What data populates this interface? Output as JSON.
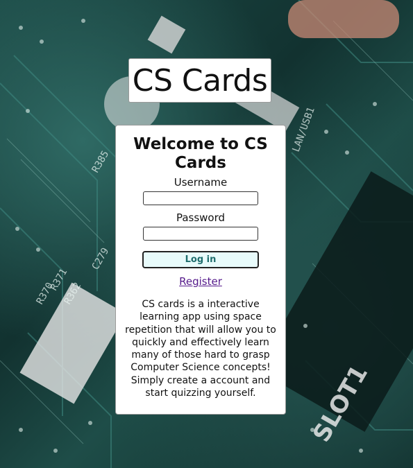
{
  "app": {
    "title": "CS Cards"
  },
  "login": {
    "heading": "Welcome to CS Cards",
    "username_label": "Username",
    "username_value": "",
    "password_label": "Password",
    "password_value": "",
    "login_button": "Log in",
    "register_link": "Register"
  },
  "description": "CS cards is a interactive learning app using space repetition that will allow you to quickly and effectively learn many of those hard to grasp Computer Science concepts! Simply create a account and start quizzing yourself.",
  "background": {
    "imprints": [
      "R385",
      "R371",
      "R362",
      "R370",
      "C279",
      "LAN/USB1",
      "SLOT1"
    ]
  },
  "colors": {
    "page_background": "#1a3a38",
    "panel_background": "#ffffff",
    "login_button_background": "#e8fbfb",
    "login_button_text": "#1f6e6e",
    "link": "#551a8b"
  }
}
